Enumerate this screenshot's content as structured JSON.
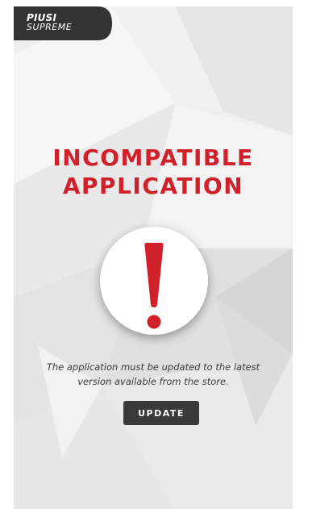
{
  "app": {
    "logo_line1": "PIUSI",
    "logo_line2": "SUPREME",
    "logo_bg_color": "#333333"
  },
  "alert": {
    "title_line1": "INCOMPATIBLE",
    "title_line2": "APPLICATION",
    "title_color": "#d0202a",
    "icon": "exclamation-icon",
    "icon_color": "#d0202a",
    "message": "The application must be updated to the latest version available from the store."
  },
  "actions": {
    "update_label": "UPDATE",
    "update_bg_color": "#3a3a3a"
  }
}
